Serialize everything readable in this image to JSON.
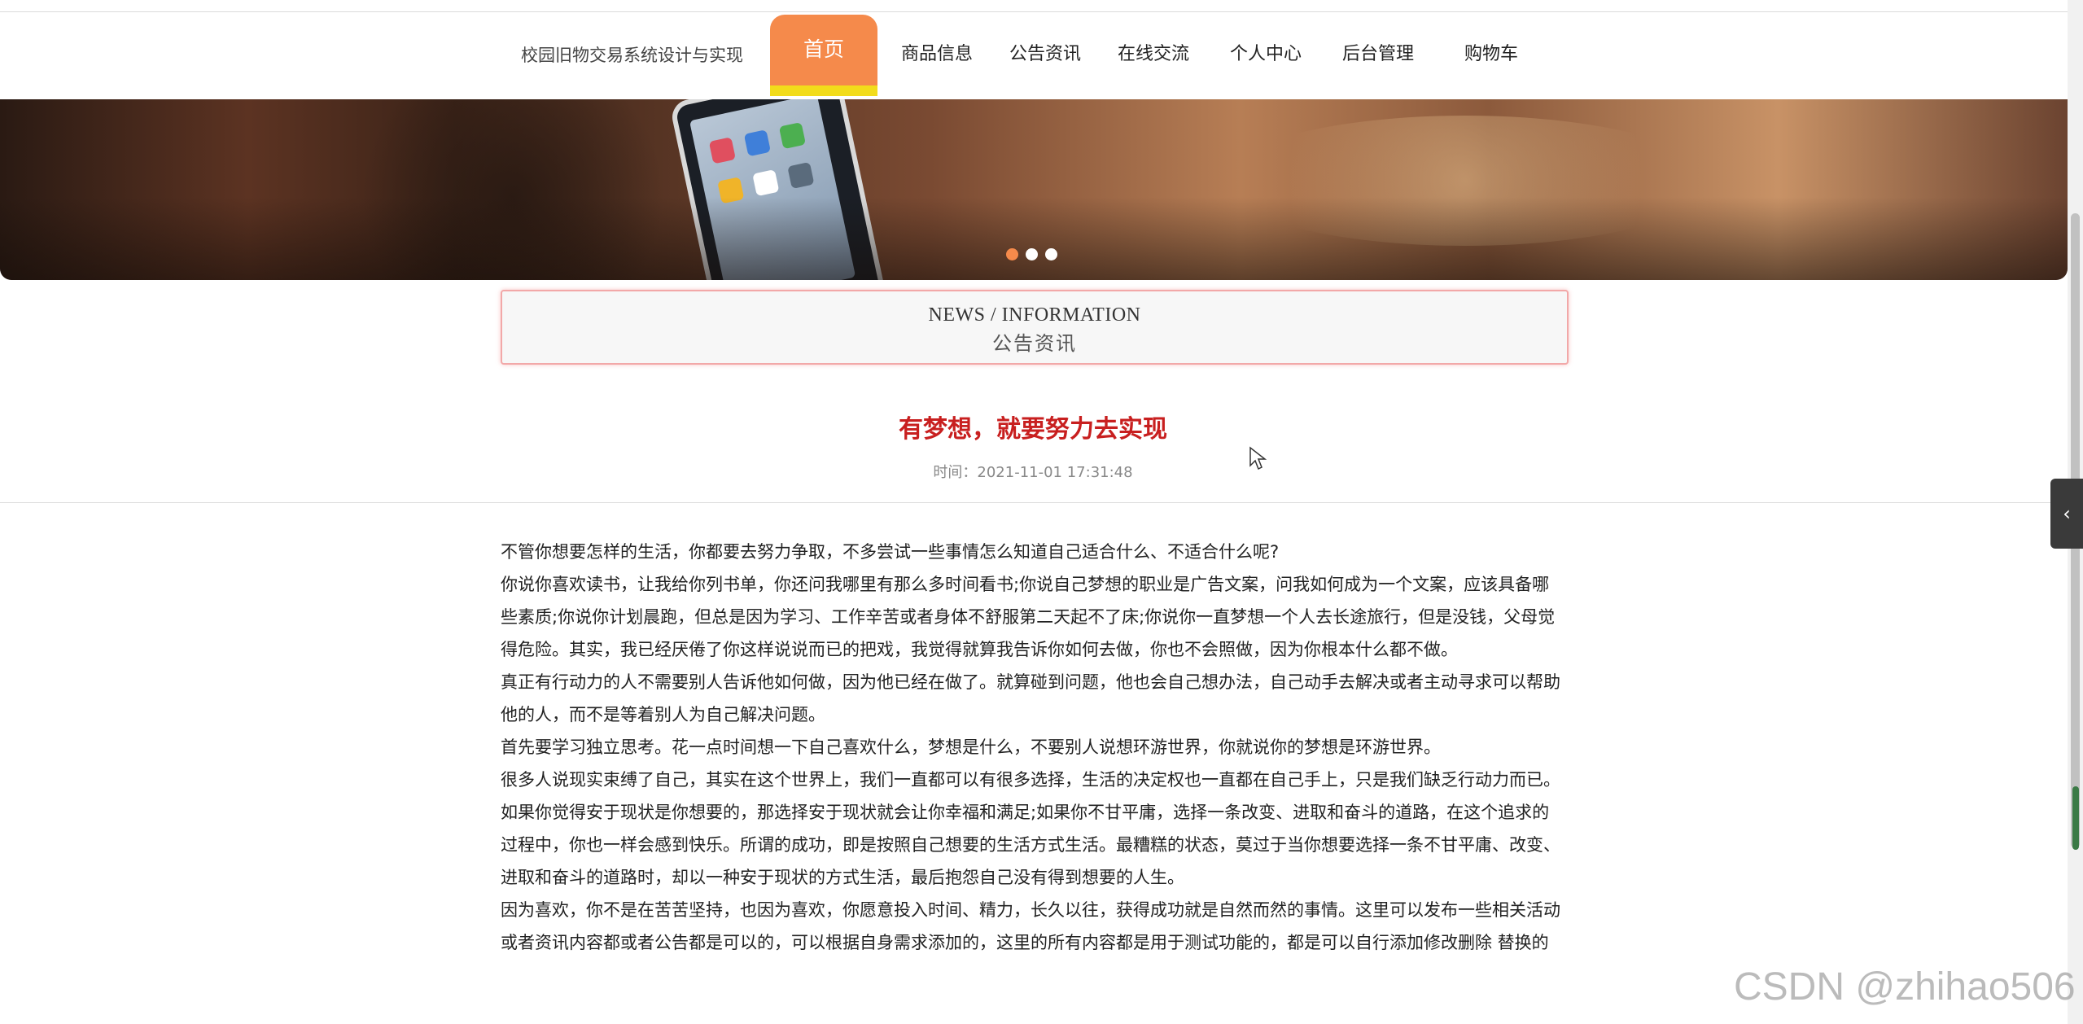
{
  "header": {
    "site_title": "校园旧物交易系统设计与实现",
    "nav": [
      {
        "label": "首页",
        "active": true
      },
      {
        "label": "商品信息"
      },
      {
        "label": "公告资讯"
      },
      {
        "label": "在线交流"
      },
      {
        "label": "个人中心"
      },
      {
        "label": "后台管理"
      },
      {
        "label": "购物车"
      }
    ],
    "accent_color": "#f58a4b",
    "underline_color": "#f2dc1b"
  },
  "banner": {
    "dots": 3,
    "active_dot": 0
  },
  "section": {
    "title_en": "NEWS / INFORMATION",
    "title_cn": "公告资讯"
  },
  "article": {
    "title": "有梦想，就要努力去实现",
    "time": "时间：2021-11-01 17:31:48",
    "title_color": "#c81f1f",
    "paragraphs": [
      "不管你想要怎样的生活，你都要去努力争取，不多尝试一些事情怎么知道自己适合什么、不适合什么呢?",
      "你说你喜欢读书，让我给你列书单，你还问我哪里有那么多时间看书;你说自己梦想的职业是广告文案，问我如何成为一个文案，应该具备哪些素质;你说你计划晨跑，但总是因为学习、工作辛苦或者身体不舒服第二天起不了床;你说你一直梦想一个人去长途旅行，但是没钱，父母觉得危险。其实，我已经厌倦了你这样说说而已的把戏，我觉得就算我告诉你如何去做，你也不会照做，因为你根本什么都不做。",
      "真正有行动力的人不需要别人告诉他如何做，因为他已经在做了。就算碰到问题，他也会自己想办法，自己动手去解决或者主动寻求可以帮助他的人，而不是等着别人为自己解决问题。",
      "首先要学习独立思考。花一点时间想一下自己喜欢什么，梦想是什么，不要别人说想环游世界，你就说你的梦想是环游世界。",
      "很多人说现实束缚了自己，其实在这个世界上，我们一直都可以有很多选择，生活的决定权也一直都在自己手上，只是我们缺乏行动力而已。",
      "如果你觉得安于现状是你想要的，那选择安于现状就会让你幸福和满足;如果你不甘平庸，选择一条改变、进取和奋斗的道路，在这个追求的过程中，你也一样会感到快乐。所谓的成功，即是按照自己想要的生活方式生活。最糟糕的状态，莫过于当你想要选择一条不甘平庸、改变、进取和奋斗的道路时，却以一种安于现状的方式生活，最后抱怨自己没有得到想要的人生。",
      "因为喜欢，你不是在苦苦坚持，也因为喜欢，你愿意投入时间、精力，长久以往，获得成功就是自然而然的事情。这里可以发布一些相关活动或者资讯内容都或者公告都是可以的，可以根据自身需求添加的，这里的所有内容都是用于测试功能的，都是可以自行添加修改删除 替换的"
    ]
  },
  "side_tab": {
    "icon": "chevron-left-icon",
    "glyph": "‹"
  },
  "watermark": "CSDN @zhihao506"
}
